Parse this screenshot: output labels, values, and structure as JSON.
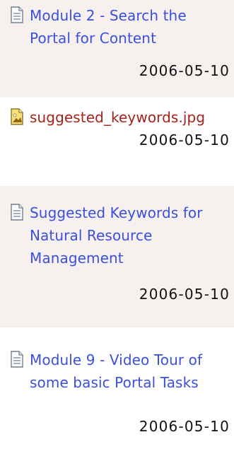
{
  "items": [
    {
      "title": "Module 2 - Search the Portal for Content",
      "date": "2006-05-10",
      "icon": "document-icon"
    },
    {
      "title": "suggested_keywords.jpg",
      "date": "2006-05-10",
      "icon": "image-file-icon"
    },
    {
      "title": "Suggested Keywords for Natural Resource Management",
      "date": "2006-05-10",
      "icon": "document-icon"
    },
    {
      "title": "Module 9 - Video Tour of some basic Portal Tasks",
      "date": "2006-05-10",
      "icon": "document-icon"
    }
  ],
  "colors": {
    "link": "#3b4fe0",
    "image_link": "#a6221a",
    "row_alt_bg": "#f6f0ef",
    "date_text": "#111111"
  }
}
